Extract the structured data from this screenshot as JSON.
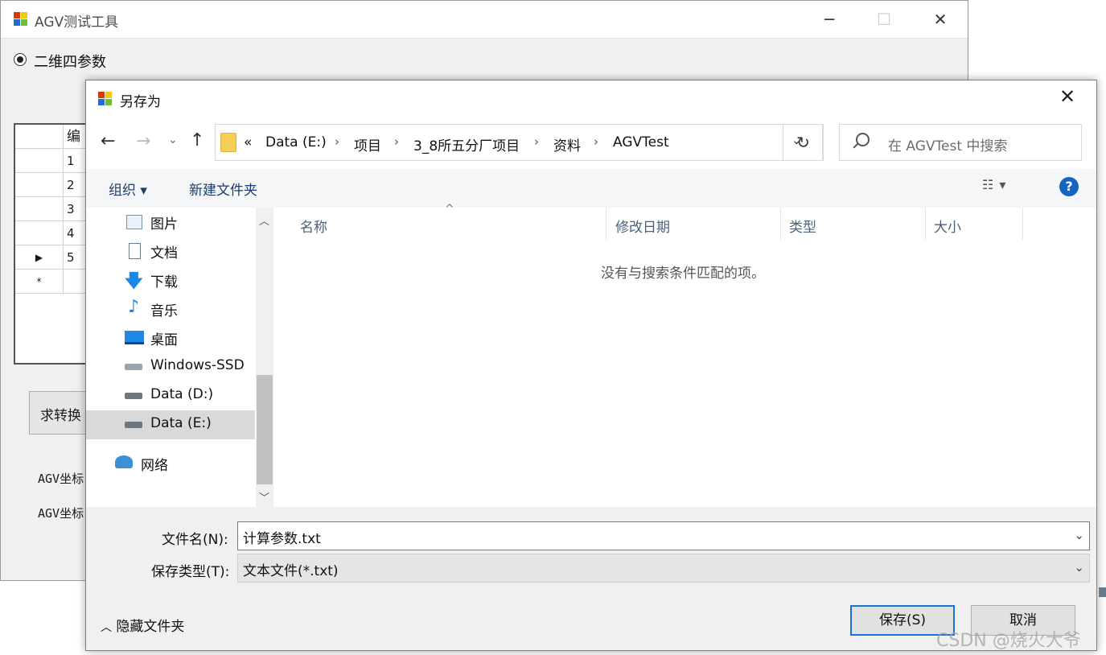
{
  "main_window": {
    "title": "AGV测试工具",
    "radio_label": "二维四参数",
    "grid": {
      "header": "编",
      "rows": [
        {
          "head": "",
          "value": "1"
        },
        {
          "head": "",
          "value": "2"
        },
        {
          "head": "",
          "value": "3"
        },
        {
          "head": "",
          "value": "4"
        },
        {
          "head": "▶",
          "value": "5"
        },
        {
          "head": "*",
          "value": ""
        }
      ]
    },
    "calc_button": "求转换",
    "agv_label_1": "AGV坐标",
    "agv_label_2": "AGV坐标"
  },
  "dialog": {
    "title": "另存为",
    "breadcrumbs": [
      "Data (E:)",
      "项目",
      "3_8所五分厂项目",
      "资料",
      "AGVTest"
    ],
    "breadcrumb_prefix": "«",
    "search_placeholder": "在 AGVTest 中搜索",
    "toolbar": {
      "organize": "组织 ▾",
      "new_folder": "新建文件夹"
    },
    "nav_items": [
      {
        "label": "图片",
        "icon": "pictures-icon"
      },
      {
        "label": "文档",
        "icon": "documents-icon"
      },
      {
        "label": "下载",
        "icon": "downloads-icon"
      },
      {
        "label": "音乐",
        "icon": "music-icon"
      },
      {
        "label": "桌面",
        "icon": "desktop-icon"
      },
      {
        "label": "Windows-SSD",
        "icon": "drive-icon"
      },
      {
        "label": "Data (D:)",
        "icon": "drive-icon"
      },
      {
        "label": "Data (E:)",
        "icon": "drive-icon",
        "selected": true
      },
      {
        "label": "网络",
        "icon": "network-icon"
      }
    ],
    "columns": [
      "名称",
      "修改日期",
      "类型",
      "大小"
    ],
    "empty_message": "没有与搜索条件匹配的项。",
    "filename_label": "文件名(N):",
    "filename_value": "计算参数.txt",
    "filetype_label": "保存类型(T):",
    "filetype_value": "文本文件(*.txt)",
    "hide_folders": "隐藏文件夹",
    "save_button": "保存(S)",
    "cancel_button": "取消"
  },
  "watermark": "CSDN @烧火大爷",
  "colors": {
    "accent": "#1a73d9",
    "help": "#1565c0",
    "selected": "#d9d9d9"
  }
}
